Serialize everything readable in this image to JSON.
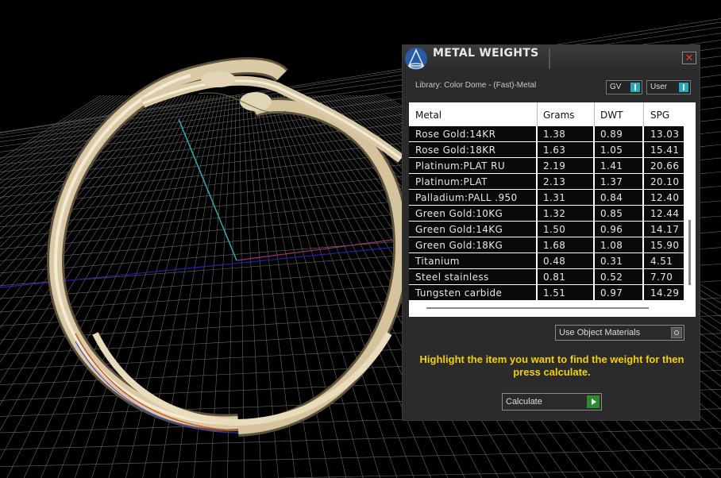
{
  "panel": {
    "title": "METAL WEIGHTS",
    "close_glyph": "✕",
    "library_label": "Library: Color Dome - (Fast)-Metal",
    "toggle_gv": "GV",
    "toggle_user": "User"
  },
  "table": {
    "headers": [
      "Metal",
      "Grams",
      "DWT",
      "SPG"
    ],
    "rows": [
      [
        "Rose Gold:14KR",
        "1.38",
        "0.89",
        "13.03"
      ],
      [
        "Rose Gold:18KR",
        "1.63",
        "1.05",
        "15.41"
      ],
      [
        "Platinum:PLAT RU",
        "2.19",
        "1.41",
        "20.66"
      ],
      [
        "Platinum:PLAT",
        "2.13",
        "1.37",
        "20.10"
      ],
      [
        "Palladium:PALL .950",
        "1.31",
        "0.84",
        "12.40"
      ],
      [
        "Green Gold:10KG",
        "1.32",
        "0.85",
        "12.44"
      ],
      [
        "Green Gold:14KG",
        "1.50",
        "0.96",
        "14.17"
      ],
      [
        "Green Gold:18KG",
        "1.68",
        "1.08",
        "15.90"
      ],
      [
        "Titanium",
        "0.48",
        "0.31",
        "4.51"
      ],
      [
        "Steel stainless",
        "0.81",
        "0.52",
        "7.70"
      ],
      [
        "Tungsten carbide",
        "1.51",
        "0.97",
        "14.29"
      ]
    ]
  },
  "controls": {
    "use_object_materials": "Use Object Materials",
    "instruction": "Highlight the item you want to find the weight for then press calculate.",
    "calculate": "Calculate"
  },
  "icons": {
    "app": "cone-app-icon",
    "close": "close-icon",
    "play": "play-icon"
  },
  "colors": {
    "accent_teal": "#2aa6b8",
    "instruction_yellow": "#f4d000",
    "close_red": "#e53a3a",
    "go_green": "#2f8a2f",
    "ring_metal": "#d9c9a6"
  }
}
